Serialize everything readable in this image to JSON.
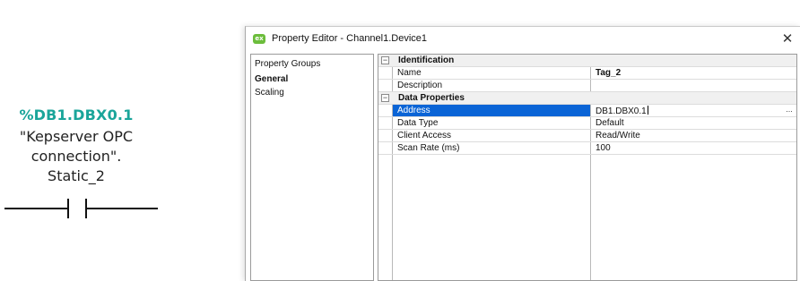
{
  "ladder": {
    "tag_address": "%DB1.DBX0.1",
    "tag_symbol_lines": [
      "\"Kepserver OPC",
      "connection\".",
      "Static_2"
    ]
  },
  "window": {
    "title": "Property Editor - Channel1.Device1",
    "app_icon_text": "ex",
    "close_glyph": "✕",
    "icon_color": "#6cbd3c"
  },
  "groups": {
    "header": "Property Groups",
    "items": [
      "General",
      "Scaling"
    ]
  },
  "grid": {
    "expander_glyph": "−",
    "ellipsis": "...",
    "categories": [
      {
        "label": "Identification",
        "properties": [
          {
            "name": "Name",
            "value": "Tag_2"
          },
          {
            "name": "Description",
            "value": ""
          }
        ]
      },
      {
        "label": "Data Properties",
        "properties": [
          {
            "name": "Address",
            "value": "DB1.DBX0.1"
          },
          {
            "name": "Data Type",
            "value": "Default"
          },
          {
            "name": "Client Access",
            "value": "Read/Write"
          },
          {
            "name": "Scan Rate (ms)",
            "value": "100"
          }
        ]
      }
    ],
    "selected_row": "Address",
    "selection_color": "#0a64d6"
  }
}
